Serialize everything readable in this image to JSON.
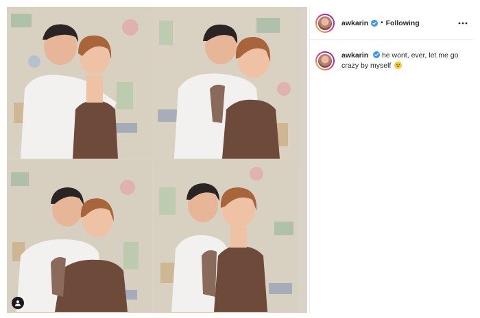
{
  "post": {
    "author": {
      "username": "awkarin",
      "verified": true,
      "follow_status": "Following",
      "separator": "•"
    },
    "caption": {
      "username": "awkarin",
      "text": "he wont, ever, let me go crazy by myself",
      "emoji": "grinning-sweat-emoji"
    },
    "media": {
      "kind": "photo-grid",
      "tiles": 4
    }
  },
  "colors": {
    "verified_blue": "#3897f0",
    "story_ring": [
      "#f9ce34",
      "#ee2a7b",
      "#6228d7"
    ],
    "border": "#efefef",
    "dress_brown": "#6e4a3a",
    "shirt_white": "#f3f1ef"
  },
  "icons": {
    "more": "more-horizontal-icon",
    "verified": "verified-badge-icon",
    "tag": "user-tag-icon"
  }
}
